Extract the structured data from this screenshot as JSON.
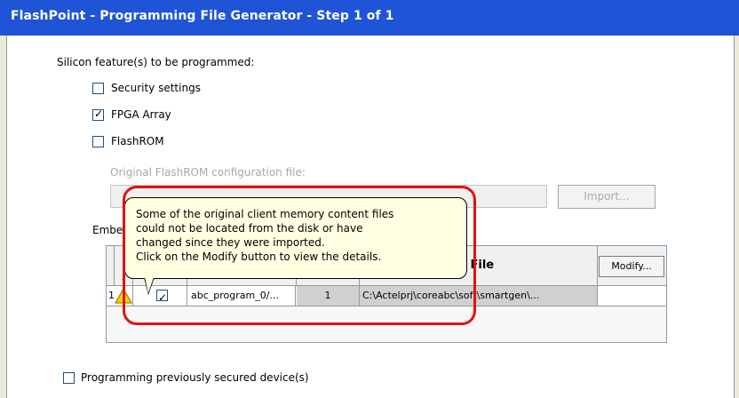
{
  "window": {
    "title": "FlashPoint - Programming File Generator   - Step 1 of 1"
  },
  "silicon": {
    "heading": "Silicon feature(s) to be programmed:",
    "security_label": "Security settings",
    "fpga_label": "FPGA Array",
    "flashrom_label": "FlashROM",
    "flashrom_file_label": "Original FlashROM configuration file:",
    "import_button": "Import..."
  },
  "embedded": {
    "label_fragment": "Embe",
    "header_configuration_file": "Configuration File",
    "row": {
      "index": "1",
      "name": "abc_program_0/...",
      "count": "1",
      "path": "C:\\Actelprj\\coreabc\\soft\\smartgen\\...",
      "modify_button": "Modify..."
    }
  },
  "tooltip": {
    "lines": [
      "Some of the original client memory content files",
      "could not be located from the disk or have",
      "changed since they were imported.",
      "Click on the Modify button to view the details."
    ]
  },
  "footer": {
    "secured_label": "Programming previously secured device(s)"
  },
  "colors": {
    "titlebar": "#1f54d6",
    "highlight": "#e51010",
    "tooltip_bg": "#ffffe1",
    "warning": "#f5d400"
  }
}
